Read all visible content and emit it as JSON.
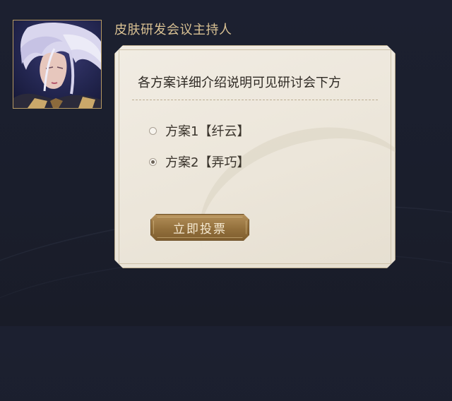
{
  "host": {
    "title": "皮肤研发会议主持人",
    "avatar_icon": "character-portrait-icon"
  },
  "panel": {
    "title": "各方案详细介绍说明可见研讨会下方",
    "options": [
      {
        "label": "方案1【纤云】",
        "selected": false
      },
      {
        "label": "方案2【弄巧】",
        "selected": true
      }
    ],
    "vote_button_label": "立即投票"
  },
  "colors": {
    "background": "#1c2030",
    "host_title": "#d9c193",
    "panel_bg": "#f1ece3",
    "button_gold": "#93703c"
  }
}
